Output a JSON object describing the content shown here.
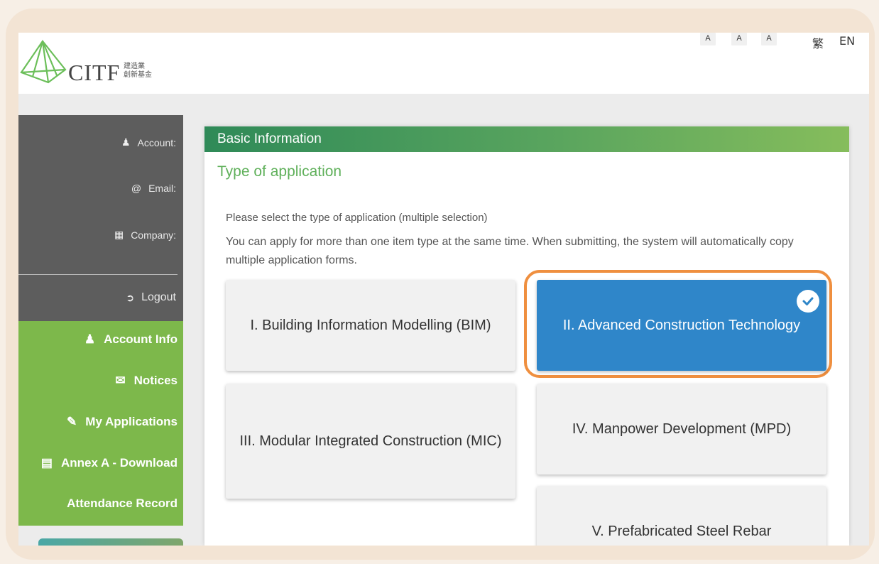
{
  "header": {
    "logo_text": "CITF",
    "logo_cn_line1": "建造業",
    "logo_cn_line2": "創新基金",
    "font_size_buttons": [
      "A",
      "A",
      "A"
    ],
    "lang_traditional": "繁",
    "lang_english": "EN"
  },
  "sidebar": {
    "account_label": "Account:",
    "email_label": "Email:",
    "company_label": "Company:",
    "logout_label": "Logout",
    "items": [
      {
        "label": "Account Info",
        "icon": "user-icon"
      },
      {
        "label": "Notices",
        "icon": "envelope-icon"
      },
      {
        "label": "My Applications",
        "icon": "external-edit-icon"
      },
      {
        "label": "Annex A - Download",
        "icon": "pdf-file-icon"
      },
      {
        "label": "Attendance Record",
        "icon": ""
      }
    ]
  },
  "main": {
    "panel_title": "Basic Information",
    "section_title": "Type of application",
    "instruction": "Please select the type of application (multiple selection)",
    "instruction_detail": "You can apply for more than one item type at the same time. When submitting, the system will automatically copy multiple application forms.",
    "application_types": [
      {
        "label": "I. Building Information Modelling (BIM)",
        "selected": false
      },
      {
        "label": "II. Advanced Construction Technology",
        "selected": true
      },
      {
        "label": "III. Modular Integrated Construction (MIC)",
        "selected": false
      },
      {
        "label": "IV. Manpower Development (MPD)",
        "selected": false
      },
      {
        "label": "V. Prefabricated Steel Rebar",
        "selected": false
      }
    ]
  },
  "colors": {
    "sidebar_dark": "#5d5d5d",
    "sidebar_green": "#7db84b",
    "selected_blue": "#2f86c9",
    "highlight_orange": "#ef8f3f",
    "header_green": "#2f8a58"
  }
}
